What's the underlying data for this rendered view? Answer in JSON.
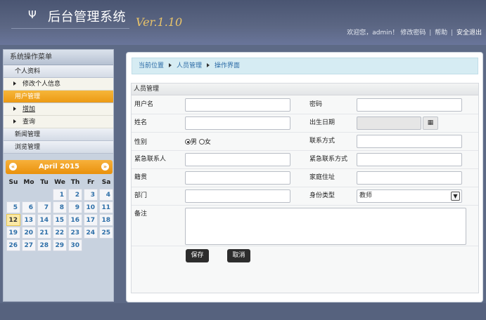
{
  "header": {
    "logo_glyph": "Ψ",
    "title": "后台管理系统",
    "version": "Ver.1.10",
    "welcome": "欢迎您，admin！",
    "change_password": "修改密码",
    "help": "帮助",
    "logout": "安全退出",
    "separator": "|"
  },
  "sidebar": {
    "title": "系统操作菜单",
    "groups": [
      {
        "label": "个人资料",
        "items": [
          {
            "label": "修改个人信息"
          }
        ]
      },
      {
        "label": "用户管理",
        "active": true,
        "items": [
          {
            "label": "增加"
          },
          {
            "label": "查询"
          }
        ]
      },
      {
        "label": "新闻管理"
      },
      {
        "label": "浏览管理"
      }
    ]
  },
  "calendar": {
    "month_label": "April 2015",
    "prev": "«",
    "next": "»",
    "weekdays": [
      "Su",
      "Mo",
      "Tu",
      "We",
      "Th",
      "Fr",
      "Sa"
    ],
    "leading_blanks": 3,
    "days": [
      "1",
      "2",
      "3",
      "4",
      "5",
      "6",
      "7",
      "8",
      "9",
      "10",
      "11",
      "12",
      "13",
      "14",
      "15",
      "16",
      "17",
      "18",
      "19",
      "20",
      "21",
      "22",
      "23",
      "24",
      "25",
      "26",
      "27",
      "28",
      "29",
      "30"
    ],
    "today": "12"
  },
  "breadcrumb": {
    "items": [
      "当前位置",
      "人员管理",
      "操作界面"
    ]
  },
  "form": {
    "title": "人员管理",
    "username_label": "用户名",
    "password_label": "密码",
    "name_label": "姓名",
    "birth_label": "出生日期",
    "calendar_button_icon": "calendar-icon",
    "gender_label": "性别",
    "gender_male": "男",
    "gender_female": "女",
    "contact_label": "联系方式",
    "emergency_person_label": "紧急联系人",
    "emergency_contact_label": "紧急联系方式",
    "native_label": "籍贯",
    "address_label": "家庭住址",
    "dept_label": "部门",
    "identity_label": "身份类型",
    "identity_value": "教师",
    "remark_label": "备注",
    "save_label": "保存",
    "cancel_label": "取消"
  },
  "colors": {
    "accent": "#ec9a13",
    "header_bg": "#5c6784",
    "link": "#2a6aa6"
  }
}
